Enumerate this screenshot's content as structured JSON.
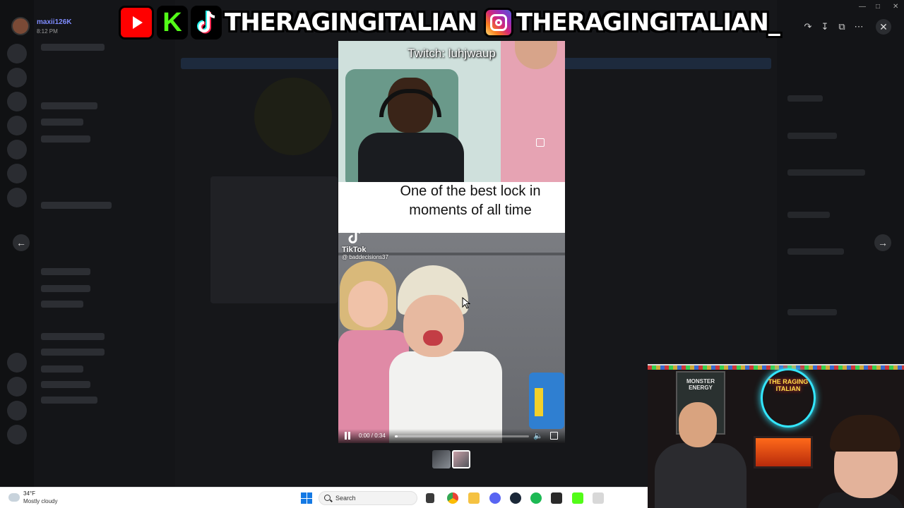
{
  "user": {
    "name": "maxii126K",
    "time": "8:12 PM"
  },
  "banner": {
    "handle_left": "THERAGINGITALIAN",
    "handle_right": "THERAGINGITALIAN_",
    "kick_letter": "K"
  },
  "video": {
    "watermark": "Twitch: luhjwaup",
    "caption_line1": "One of the best lock in",
    "caption_line2": "moments of all time",
    "tiktok_brand": "TikTok",
    "tiktok_user": "@ baddecisions37",
    "time": "0:00 / 0:34",
    "progress": 0.02
  },
  "webcam": {
    "fridge_text": "MONSTER ENERGY",
    "neon_text": "THE RAGING ITALIAN"
  },
  "taskbar": {
    "temperature": "34°F",
    "condition": "Mostly cloudy",
    "search_label": "Search"
  },
  "icons": {
    "close": "close-icon",
    "prev": "arrow-left-icon",
    "next": "arrow-right-icon",
    "forward": "forward-icon",
    "download": "download-icon",
    "open": "open-external-icon",
    "more": "more-icon"
  },
  "colors": {
    "youtube": "#ff0000",
    "kick": "#53fc18",
    "windows": "#1479e4",
    "discord_bg": "#16171a"
  }
}
